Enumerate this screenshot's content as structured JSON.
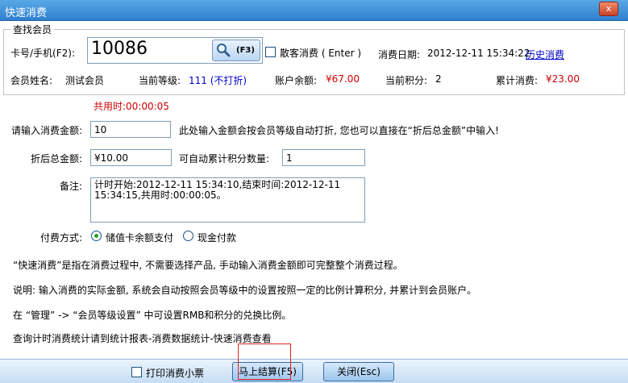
{
  "window": {
    "title": "快速消费",
    "close_glyph": "x"
  },
  "member_search": {
    "legend": "查找会员",
    "card_label": "卡号/手机(F2):",
    "card_value": "10086",
    "search_button_label": "(F3)",
    "guest_label": "散客消费 ( Enter )",
    "date_label": "消费日期:",
    "date_value": "2012-12-11 15:34:22",
    "history_link": "历史消费",
    "member_name_label": "会员姓名:",
    "member_name_value": "测试会员",
    "level_label": "当前等级:",
    "level_value": "111 (不打折)",
    "balance_label": "账户余额:",
    "balance_value": "¥67.00",
    "points_label": "当前积分:",
    "points_value": "2",
    "total_label": "累计消费:",
    "total_value": "¥23.00"
  },
  "timer": {
    "text": "共用时:00:00:05"
  },
  "form": {
    "amount_label": "请输入消费金额:",
    "amount_value": "10",
    "amount_hint": "此处输入金额会按会员等级自动打折, 您也可以直接在“折后总金额”中输入!",
    "discount_label": "折后总金额:",
    "discount_value": "¥10.00",
    "points_accum_label": "可自动累计积分数量:",
    "points_accum_value": "1",
    "remark_label": "备注:",
    "remark_value": "计时开始:2012-12-11 15:34:10,结束时间:2012-12-11 15:34:15,共用时:00:00:05。",
    "payment_label": "付费方式:",
    "payment_options": [
      "储值卡余额支付",
      "现金付款"
    ],
    "payment_selected": "储值卡余额支付"
  },
  "notes": [
    "“快速消费”是指在消费过程中, 不需要选择产品, 手动输入消费金额即可完整整个消费过程。",
    "说明: 输入消费的实际金额, 系统会自动按照会员等级中的设置按照一定的比例计算积分, 并累计到会员账户。",
    "在 “管理” -> “会员等级设置” 中可设置RMB和积分的兑换比例。",
    "查询计时消费统计请到统计报表-消费数据统计-快速消费查看"
  ],
  "footer": {
    "print_receipt_label": "打印消费小票",
    "checkout_button": "马上结算(F5)",
    "close_button": "关闭(Esc)"
  },
  "colors": {
    "titlebar": "#3a8ad6",
    "accent_red": "#d00000",
    "link_blue": "#0000cc"
  }
}
